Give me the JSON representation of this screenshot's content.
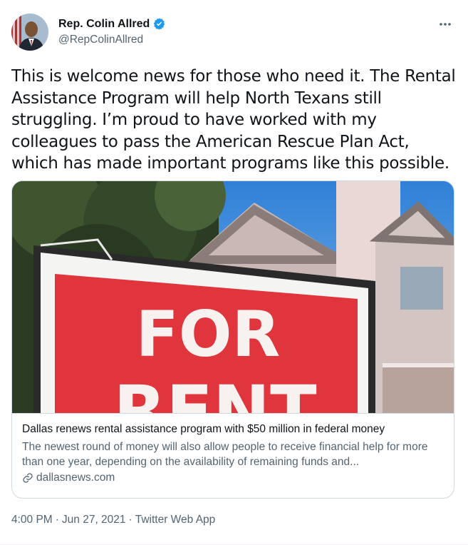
{
  "author": {
    "display_name": "Rep. Colin Allred",
    "handle": "@RepColinAllred",
    "verified": true
  },
  "more_icon": "more-horizontal-icon",
  "tweet_text": "This is welcome news for those who need it. The Rental Assistance Program will help North Texans still struggling. I’m proud to have worked with my colleagues to pass the American Rescue Plan Act, which has made important programs like this possible.",
  "card": {
    "image_text_line1": "FOR",
    "image_text_line2": "RENT",
    "title": "Dallas renews rental assistance program with $50 million in federal money",
    "description": "The newest round of money will also allow people to receive financial help for more than one year, depending on the availability of remaining funds and...",
    "domain": "dallasnews.com",
    "domain_icon": "link-icon"
  },
  "meta": {
    "time": "4:00 PM",
    "separator": "·",
    "date": "Jun 27, 2021",
    "separator2": "·",
    "source": "Twitter Web App"
  },
  "colors": {
    "verified_blue": "#1d9bf0",
    "secondary_text": "#536471",
    "sign_red": "#e0353d"
  }
}
